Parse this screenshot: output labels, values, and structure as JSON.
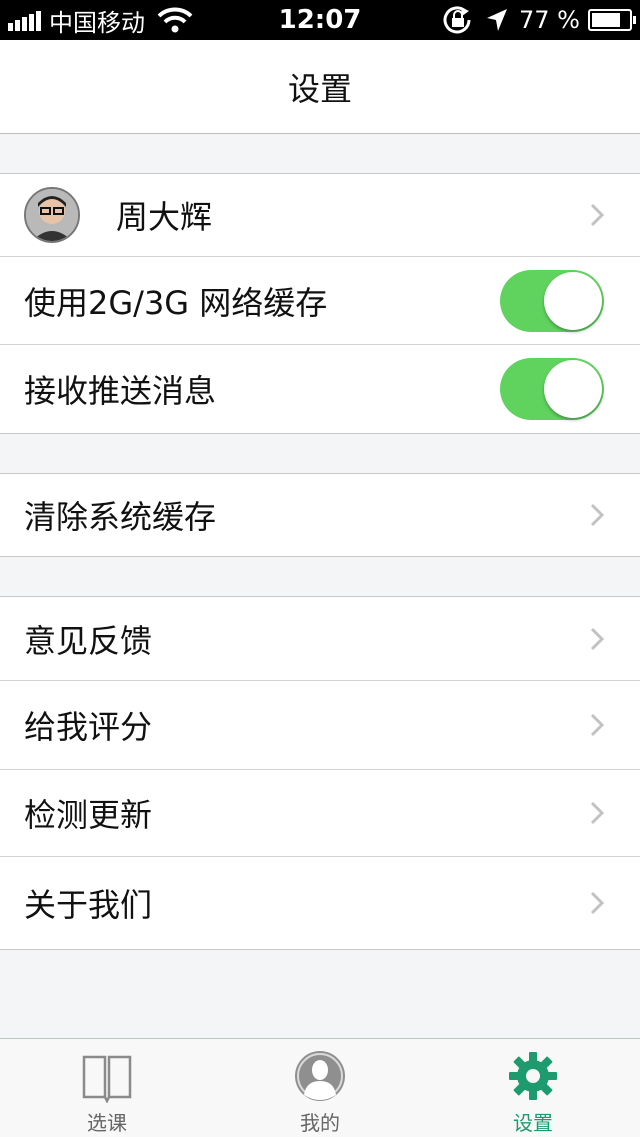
{
  "status_bar": {
    "carrier": "中国移动",
    "time": "12:07",
    "battery_percent": "77 %",
    "battery_level": 0.77
  },
  "nav": {
    "title": "设置"
  },
  "profile": {
    "name": "周大辉"
  },
  "settings": {
    "cache_network": {
      "label": "使用2G/3G 网络缓存",
      "enabled": true
    },
    "push": {
      "label": "接收推送消息",
      "enabled": true
    },
    "clear_cache": {
      "label": "清除系统缓存"
    },
    "feedback": {
      "label": "意见反馈"
    },
    "rate": {
      "label": "给我评分"
    },
    "update": {
      "label": "检测更新"
    },
    "about": {
      "label": "关于我们"
    }
  },
  "tabs": [
    {
      "label": "选课",
      "icon": "book-icon",
      "active": false
    },
    {
      "label": "我的",
      "icon": "user-icon",
      "active": false
    },
    {
      "label": "设置",
      "icon": "gear-icon",
      "active": true
    }
  ],
  "colors": {
    "toggle_on": "#5fd35e",
    "accent": "#1e9b6e",
    "background": "#f4f5f6"
  }
}
